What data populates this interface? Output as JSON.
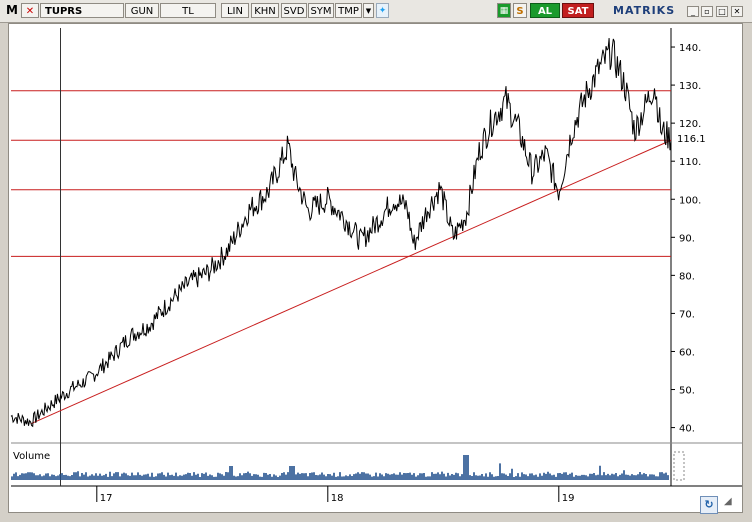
{
  "toolbar": {
    "logo": "M",
    "symbol": "TUPRS",
    "buttons": [
      "GUN",
      "TL",
      "LIN",
      "KHN",
      "SVD",
      "SYM",
      "TMP"
    ],
    "refresh_icon": "S",
    "buy_label": "AL",
    "sell_label": "SAT",
    "brand": "MATRIKS"
  },
  "chart_data": {
    "type": "line",
    "symbol": "TUPRS",
    "y_ticks": [
      140,
      130,
      120,
      110,
      100,
      90,
      80,
      70,
      60,
      50,
      40
    ],
    "y_range": [
      37,
      145
    ],
    "x_ticks": [
      "17",
      "18",
      "19"
    ],
    "last_value": "116.1",
    "horizontal_levels": [
      128.5,
      115.5,
      102.5,
      85
    ],
    "trendline": {
      "start": [
        0.03,
        41
      ],
      "end": [
        1.0,
        115.5
      ]
    },
    "vertical_marker": 0.075,
    "volume_label": "Volume",
    "price_anchors": [
      [
        0.0,
        43
      ],
      [
        0.03,
        41.5
      ],
      [
        0.06,
        46
      ],
      [
        0.09,
        50
      ],
      [
        0.12,
        53
      ],
      [
        0.15,
        58
      ],
      [
        0.18,
        64
      ],
      [
        0.21,
        67
      ],
      [
        0.24,
        73
      ],
      [
        0.27,
        78
      ],
      [
        0.3,
        81
      ],
      [
        0.33,
        87
      ],
      [
        0.36,
        97
      ],
      [
        0.39,
        102
      ],
      [
        0.42,
        114
      ],
      [
        0.43,
        106
      ],
      [
        0.45,
        97
      ],
      [
        0.48,
        100
      ],
      [
        0.51,
        94
      ],
      [
        0.53,
        89
      ],
      [
        0.55,
        93
      ],
      [
        0.58,
        100
      ],
      [
        0.6,
        98
      ],
      [
        0.61,
        88
      ],
      [
        0.63,
        97
      ],
      [
        0.65,
        103
      ],
      [
        0.67,
        90
      ],
      [
        0.69,
        96
      ],
      [
        0.71,
        113
      ],
      [
        0.73,
        121
      ],
      [
        0.75,
        126
      ],
      [
        0.77,
        118
      ],
      [
        0.79,
        107
      ],
      [
        0.81,
        112
      ],
      [
        0.83,
        102
      ],
      [
        0.85,
        118
      ],
      [
        0.87,
        127
      ],
      [
        0.89,
        134
      ],
      [
        0.91,
        139
      ],
      [
        0.93,
        130
      ],
      [
        0.945,
        118
      ],
      [
        0.96,
        124
      ],
      [
        0.975,
        130
      ],
      [
        0.985,
        118
      ],
      [
        1.0,
        116
      ]
    ]
  },
  "colors": {
    "levels": "#c81e1e",
    "trendline": "#c81e1e",
    "price": "#000000",
    "volume": "#1f4e8c",
    "grid": "#8a8a8a"
  }
}
